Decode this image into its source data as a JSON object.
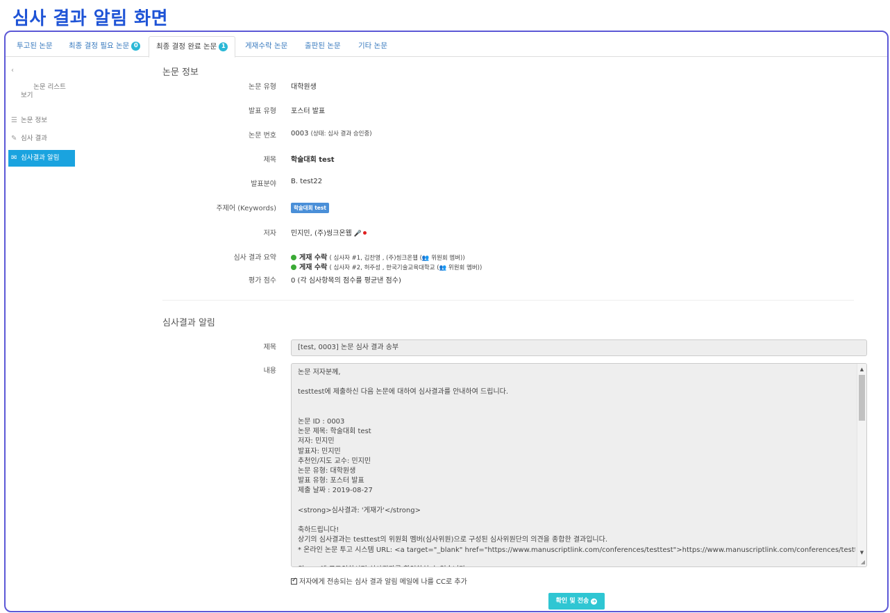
{
  "page_title": "심사 결과 알림 화면",
  "tabs": [
    {
      "label": "투고된 논문",
      "badge": ""
    },
    {
      "label": "최종 결정 필요 논문",
      "badge": "0"
    },
    {
      "label": "최종 결정 완료 논문",
      "badge": "1"
    },
    {
      "label": "게재수락 논문",
      "badge": ""
    },
    {
      "label": "출판된 논문",
      "badge": ""
    },
    {
      "label": "기타 논문",
      "badge": ""
    }
  ],
  "sidebar": {
    "items": [
      {
        "label": "논문 리스트\n보기",
        "icon": "chevron-left-icon"
      },
      {
        "label": "논문 정보",
        "icon": "list-icon"
      },
      {
        "label": "심사 결과",
        "icon": "edit-icon"
      },
      {
        "label": "심사결과 알림",
        "icon": "envelope-icon"
      }
    ]
  },
  "paper_info": {
    "heading": "논문 정보",
    "type_label": "논문 유형",
    "type_value": "대학원생",
    "presentation_label": "발표 유형",
    "presentation_value": "포스터 발표",
    "number_label": "논문 번호",
    "number_value": "0003",
    "number_status": "(상태: 심사 결과 승인중)",
    "title_label": "제목",
    "title_value": "학술대회 test",
    "field_label": "발표분야",
    "field_value": "B. test22",
    "keywords_label": "주제어 (Keywords)",
    "keyword": "학술대회 test",
    "author_label": "저자",
    "author_value": "민지민, (주)씽크온웹",
    "summary_label": "심사 결과 요약",
    "summary": [
      {
        "decision": "게재 수락",
        "detail": "( 심사자 #1, 김찬영 , (주)씽크온웹 (",
        "role": " 위원회 멤버))"
      },
      {
        "decision": "게재 수락",
        "detail": "( 심사자 #2, 허주성 , 한국기술교육대학교 (",
        "role": " 위원회 멤버))"
      }
    ],
    "score_label": "평가 점수",
    "score_value": "0 (각 심사항목의 점수를 평균낸 점수)"
  },
  "notification": {
    "heading": "심사결과 알림",
    "subject_label": "제목",
    "subject_value": "[test, 0003] 논문 심사 결과 송부",
    "content_label": "내용",
    "content_value": "논문 저자분께,\n\ntesttest에 제출하신 다음 논문에 대하여 심사결과를 안내하여 드립니다.\n\n\n논문 ID : 0003\n논문 제목: 학술대회 test\n저자: 민지민\n발표자: 민지민\n추천인/지도 교수: 민지민\n논문 유형: 대학원생\n발표 유형: 포스터 발표\n제출 날짜 : 2019-08-27\n\n<strong>심사결과: '게재가'</strong>\n\n축하드립니다!\n상기의 심사결과는 testtest의 위원회 멤버(심사위원)으로 구성된 심사위원단의 의견을 종합한 결과입니다.\n* 온라인 논문 투고 시스템 URL: <a target=\"_blank\" href=\"https://www.manuscriptlink.com/conferences/testtest\">https://www.manuscriptlink.com/conferences/testtest</a>\n\n위 URL에 로그인하시면 심사결과를 확인하실 수 있습니다.",
    "cc_label": "저자에게 전송되는 심사 결과 알림 메일에 나를 CC로 추가",
    "cc_checked": true,
    "submit_label": "확인 및 전송"
  },
  "colors": {
    "accent": "#1aa3df",
    "button": "#2fc6d3",
    "title": "#1f54d6",
    "frame": "#5b57d6",
    "badge": "#2bb8d6"
  }
}
